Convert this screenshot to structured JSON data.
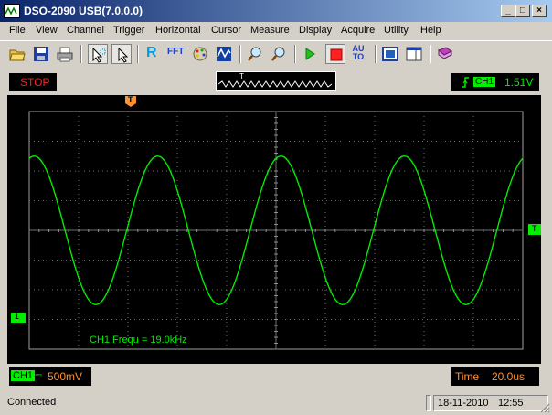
{
  "window": {
    "title": "DSO-2090 USB(7.0.0.0)",
    "min_glyph": "_",
    "max_glyph": "□",
    "close_glyph": "×"
  },
  "menu": [
    "File",
    "View",
    "Channel",
    "Trigger",
    "Horizontal",
    "Cursor",
    "Measure",
    "Display",
    "Acquire",
    "Utility",
    "Help"
  ],
  "toolbar": {
    "icons": [
      "open-folder-icon",
      "save-disk-icon",
      "print-icon",
      "pointer-select-icon",
      "pointer-icon",
      "reference-r-icon",
      "fft-icon",
      "palette-icon",
      "waveform-display-icon",
      "zoom-in-icon",
      "zoom-out-icon",
      "run-play-icon",
      "stop-square-icon",
      "auto-to-icon",
      "fit-screen-icon",
      "window-layout-icon",
      "book-icon"
    ],
    "r_label": "R",
    "fft_label": "FFT",
    "auto_label": "AU TO"
  },
  "scope_status": {
    "run_state": "STOP",
    "trigger_label": "T",
    "trigger_channel": "CH1",
    "trigger_level": "1.51V"
  },
  "scope": {
    "trace_color": "#00ee00",
    "ch1_marker": "1",
    "trigger_marker": "T",
    "measurement": "CH1:Frequ = 19.0kHz",
    "signal": {
      "period_div": 2.5,
      "amplitude_div": 2.5,
      "phase_div": 0.1
    }
  },
  "bottom": {
    "ch1_label": "CH1",
    "coupling": "⎓",
    "volts_div": "500mV",
    "time_label": "Time",
    "time_div": "20.0us"
  },
  "statusbar": {
    "connection": "Connected",
    "date": "18-11-2010",
    "time": "12:55"
  }
}
